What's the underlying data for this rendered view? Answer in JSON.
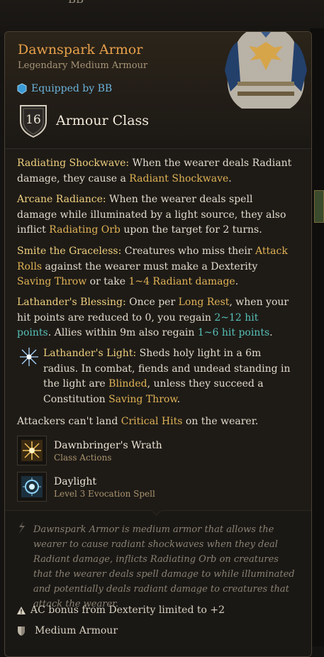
{
  "background": {
    "top_text": "BB"
  },
  "item": {
    "name": "Dawnspark Armor",
    "subtitle": "Legendary Medium Armour",
    "equipped": "Equipped by BB",
    "ac_value": "16",
    "ac_label": "Armour Class"
  },
  "properties": [
    {
      "title": "Radiating Shockwave:",
      "t1": " When the wearer deals Radiant damage, they cause a ",
      "k1": "Radiant Shockwave",
      "t2": "."
    },
    {
      "title": "Arcane Radiance:",
      "t1": " When the wearer deals spell damage while illuminated by a light source, they also inflict ",
      "k1": "Radiating Orb",
      "t2": " upon the target for 2 turns."
    },
    {
      "title": "Smite the Graceless:",
      "t1": " Creatures who miss their ",
      "k1": "Attack Rolls",
      "t2": " against the wearer must make a Dexterity ",
      "k2": "Saving Throw",
      "t3": " or take ",
      "k3": "1~4 Radiant damage",
      "t4": "."
    },
    {
      "title": "Lathander's Blessing:",
      "t1": " Once per ",
      "k1": "Long Rest",
      "t2": ", when your hit points are reduced to 0, you regain ",
      "h1": "2~12 hit points",
      "t3": ". Allies within 9m also regain ",
      "h2": "1~6 hit points",
      "t4": "."
    },
    {
      "title": "Lathander's Light:",
      "t1": " Sheds holy light in a 6m radius. In combat, fiends and undead standing in the light are ",
      "k1": "Blinded",
      "t2": ", unless they succeed a Constitution ",
      "k2": "Saving Throw",
      "t3": "."
    }
  ],
  "attackers": {
    "t1": "Attackers can't land ",
    "k1": "Critical Hits",
    "t2": " on the wearer."
  },
  "abilities": [
    {
      "name": "Dawnbringer's Wrath",
      "sub": "Class Actions",
      "icon": "sunburst-icon"
    },
    {
      "name": "Daylight",
      "sub": "Level 3 Evocation Spell",
      "icon": "daylight-icon"
    }
  ],
  "flavor": "Dawnspark Armor is medium armor that allows the wearer to cause radiant shockwaves when they deal Radiant damage, inflicts Radiating Orb on creatures that the wearer deals spell damage to while illuminated and potentially deals radiant damage to creatures that attack the wearer.",
  "footer": {
    "dex_limit": "AC bonus from Dexterity limited to +2",
    "armour_type": "Medium Armour"
  },
  "colors": {
    "title": "#e8a04b",
    "keyword": "#e0b255",
    "heal": "#56c0b6",
    "equipped": "#6ab4dc"
  }
}
